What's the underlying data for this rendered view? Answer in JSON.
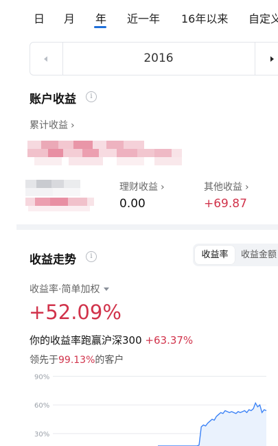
{
  "period_tabs": [
    "日",
    "月",
    "年",
    "近一年",
    "16年以来",
    "自定义"
  ],
  "active_tab": "年",
  "year": "2016",
  "account_income": {
    "title": "账户收益",
    "info_icon": "info-icon",
    "cumulative_label": "累计收益",
    "wealth_label": "理财收益",
    "wealth_value": "0.00",
    "other_label": "其他收益",
    "other_value": "+69.87"
  },
  "trend": {
    "title": "收益走势",
    "toggle": [
      "收益率",
      "收益金额"
    ],
    "toggle_active": "收益率",
    "metric_label": "收益率·简单加权",
    "rate": "+52.09%",
    "compare_text": "你的收益率跑赢沪深300",
    "compare_value": "+63.37%",
    "lead_prefix": "领先于",
    "lead_value": "99.13%",
    "lead_suffix": "的客户"
  },
  "colors": {
    "accent_blue": "#1e6fd9",
    "gain_red": "#d1334b",
    "chart_line": "#3b82f6",
    "chart_fill": "#eaf2fd"
  },
  "chart_data": {
    "type": "area",
    "y_tick_labels": [
      "90%",
      "60%",
      "30%"
    ],
    "y_ticks": [
      90,
      60,
      30
    ],
    "ylim": [
      17,
      96
    ],
    "x_index_range": [
      0,
      100
    ],
    "grid": true,
    "series": [
      {
        "x": [
          0,
          2,
          4,
          6,
          7,
          8,
          10,
          12,
          14,
          16,
          18,
          20,
          22,
          24,
          26,
          28,
          30,
          32,
          34,
          36,
          38,
          40,
          42,
          44,
          46,
          48,
          50,
          52,
          54,
          56,
          58,
          60,
          62,
          64,
          66,
          68,
          70,
          72,
          74,
          76,
          78,
          80,
          82,
          84,
          86,
          88,
          90,
          92,
          94,
          96,
          98,
          100
        ],
        "y": [
          17,
          17,
          17,
          17,
          17,
          17,
          17,
          17,
          17,
          17,
          17,
          17,
          17,
          17,
          17,
          17,
          17,
          17,
          17,
          17,
          18,
          37,
          39,
          38,
          41,
          43,
          45,
          44,
          48,
          50,
          52,
          51,
          54,
          53,
          52,
          53,
          52,
          51,
          53,
          52,
          53,
          54,
          52,
          55,
          54,
          56,
          62,
          58,
          60,
          52,
          55,
          54
        ]
      }
    ]
  }
}
